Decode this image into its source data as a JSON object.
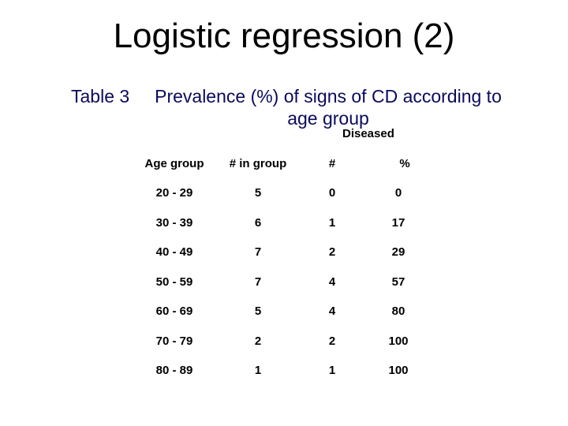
{
  "title": "Logistic regression (2)",
  "caption": {
    "label": "Table 3",
    "text": "Prevalence (%) of signs of CD according to age group"
  },
  "table": {
    "group_header": "Diseased",
    "columns": [
      "Age group",
      "# in group",
      "#",
      "%"
    ],
    "rows": [
      [
        "20 - 29",
        "5",
        "0",
        "0"
      ],
      [
        "30 - 39",
        "6",
        "1",
        "17"
      ],
      [
        "40 - 49",
        "7",
        "2",
        "29"
      ],
      [
        "50 - 59",
        "7",
        "4",
        "57"
      ],
      [
        "60 - 69",
        "5",
        "4",
        "80"
      ],
      [
        "70 - 79",
        "2",
        "2",
        "100"
      ],
      [
        "80 - 89",
        "1",
        "1",
        "100"
      ]
    ]
  }
}
